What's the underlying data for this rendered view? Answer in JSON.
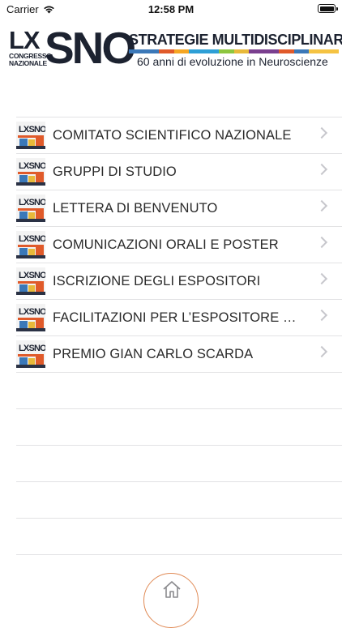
{
  "status_bar": {
    "carrier": "Carrier",
    "time": "12:58 PM",
    "wifi_icon": "wifi-icon",
    "battery_icon": "battery-icon",
    "battery_level": 1.0
  },
  "banner": {
    "logo_lx": "LX",
    "logo_congresso": "CONGRESSO",
    "logo_nazionale": "NAZIONALE",
    "logo_sno": "SNO",
    "title": "STRATEGIE MULTIDISCIPLINARI",
    "subtitle": "60 anni di evoluzione in Neuroscienze",
    "strip_colors": [
      "#3b78b8",
      "#e05a2a",
      "#f5a623",
      "#2e9fd6",
      "#8dc63f",
      "#e8b93a",
      "#7a3f8f",
      "#e05a2a",
      "#3b78b8",
      "#f5c342"
    ]
  },
  "menu": {
    "items": [
      {
        "label": "COMITATO SCIENTIFICO NAZIONALE",
        "thumb_text": "LXSNO"
      },
      {
        "label": "GRUPPI DI STUDIO",
        "thumb_text": "LXSNO"
      },
      {
        "label": "LETTERA DI BENVENUTO",
        "thumb_text": "LXSNO"
      },
      {
        "label": "COMUNICAZIONI ORALI E POSTER",
        "thumb_text": "LXSNO"
      },
      {
        "label": "ISCRIZIONE DEGLI ESPOSITORI",
        "thumb_text": "LXSNO"
      },
      {
        "label": "FACILITAZIONI PER L’ESPOSITORE UN...",
        "thumb_text": "LXSNO"
      },
      {
        "label": "PREMIO GIAN CARLO SCARDA",
        "thumb_text": "LXSNO"
      }
    ],
    "chevron_icon": "chevron-right-icon"
  },
  "footer": {
    "home_icon": "home-icon",
    "accent_color": "#e08a55"
  }
}
